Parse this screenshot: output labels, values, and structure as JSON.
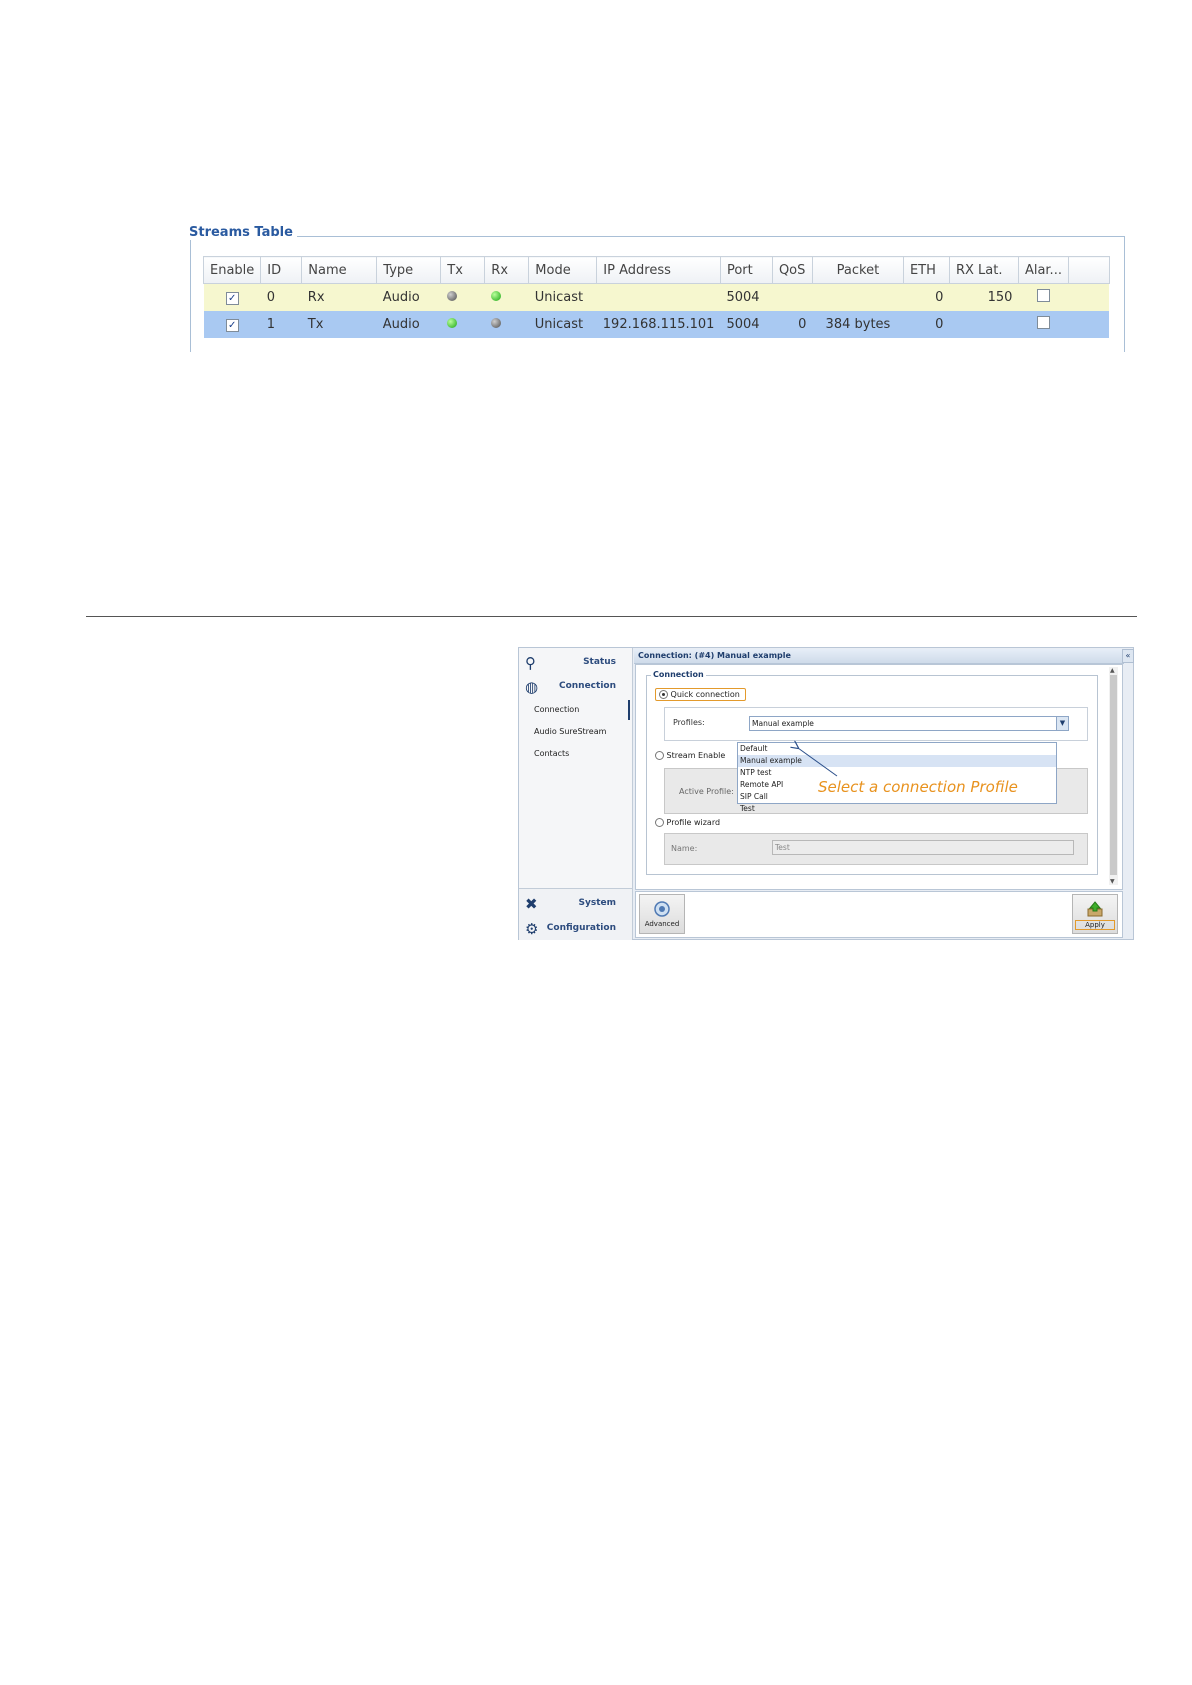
{
  "streams": {
    "title": "Streams Table",
    "columns": [
      "Enable",
      "ID",
      "Name",
      "Type",
      "Tx",
      "Rx",
      "Mode",
      "IP Address",
      "Port",
      "QoS",
      "Packet",
      "ETH",
      "RX Lat.",
      "Alar..."
    ],
    "rows": [
      {
        "enable": true,
        "id": "0",
        "name": "Rx",
        "type": "Audio",
        "tx": "gray",
        "rx": "green",
        "mode": "Unicast",
        "ip": "",
        "port": "5004",
        "qos": "",
        "packet": "",
        "eth": "0",
        "rxlat": "150",
        "alarm": false,
        "highlight": "#f6f7cf"
      },
      {
        "enable": true,
        "id": "1",
        "name": "Tx",
        "type": "Audio",
        "tx": "green",
        "rx": "gray",
        "mode": "Unicast",
        "ip": "192.168.115.101",
        "port": "5004",
        "qos": "0",
        "packet": "384 bytes",
        "eth": "0",
        "rxlat": "",
        "alarm": false,
        "highlight": "#a9c9f2"
      }
    ]
  },
  "app": {
    "nav": {
      "status": "Status",
      "connection": "Connection",
      "sub_items": [
        "Connection",
        "Audio SureStream",
        "Contacts"
      ],
      "system": "System",
      "configuration": "Configuration"
    },
    "title": "Connection: (#4) Manual example",
    "collapse_glyph": "«",
    "group_legend": "Connection",
    "quick_connection": "Quick connection",
    "profiles_label": "Profiles:",
    "profiles_value": "Manual example",
    "profiles_options": [
      "Default",
      "Manual example",
      "NTP test",
      "Remote API",
      "SIP Call",
      "Test"
    ],
    "stream_enable": "Stream Enable",
    "active_profile_label": "Active Profile:",
    "profile_wizard": "Profile wizard",
    "name_label": "Name:",
    "name_value": "Test",
    "advanced_label": "Advanced",
    "apply_label": "Apply"
  },
  "annotation": "Select a connection Profile",
  "colors": {
    "accent": "#2a5aa0",
    "highlight_orange": "#e8921e",
    "nav_text": "#1f3e6d"
  }
}
